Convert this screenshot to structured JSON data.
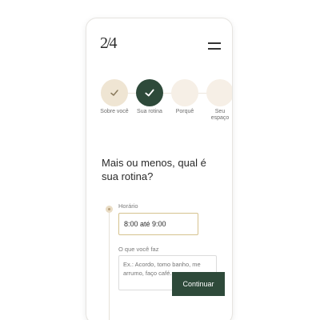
{
  "logo": {
    "text": "2/4"
  },
  "menu": {
    "icon": "hamburger-icon"
  },
  "steps": [
    {
      "label": "Sobre você",
      "state": "done",
      "icon": "check-icon"
    },
    {
      "label": "Sua rotina",
      "state": "current",
      "icon": "check-icon"
    },
    {
      "label": "Porquê",
      "state": "todo",
      "icon": ""
    },
    {
      "label": "Seu espaço",
      "state": "todo",
      "icon": ""
    }
  ],
  "question": "Mais ou menos, qual é sua rotina?",
  "schedule": {
    "label": "Horário",
    "value": "8:00 até 9:00"
  },
  "activity": {
    "label": "O que você faz",
    "placeholder": "Ex.: Acordo, tomo banho, me arrumo, faço café..."
  },
  "continue_label": "Continuar",
  "colors": {
    "primary": "#2e4a3a",
    "accent_gold": "#d6c28f",
    "step_done": "#efe5d3",
    "step_todo": "#f6efe6"
  }
}
